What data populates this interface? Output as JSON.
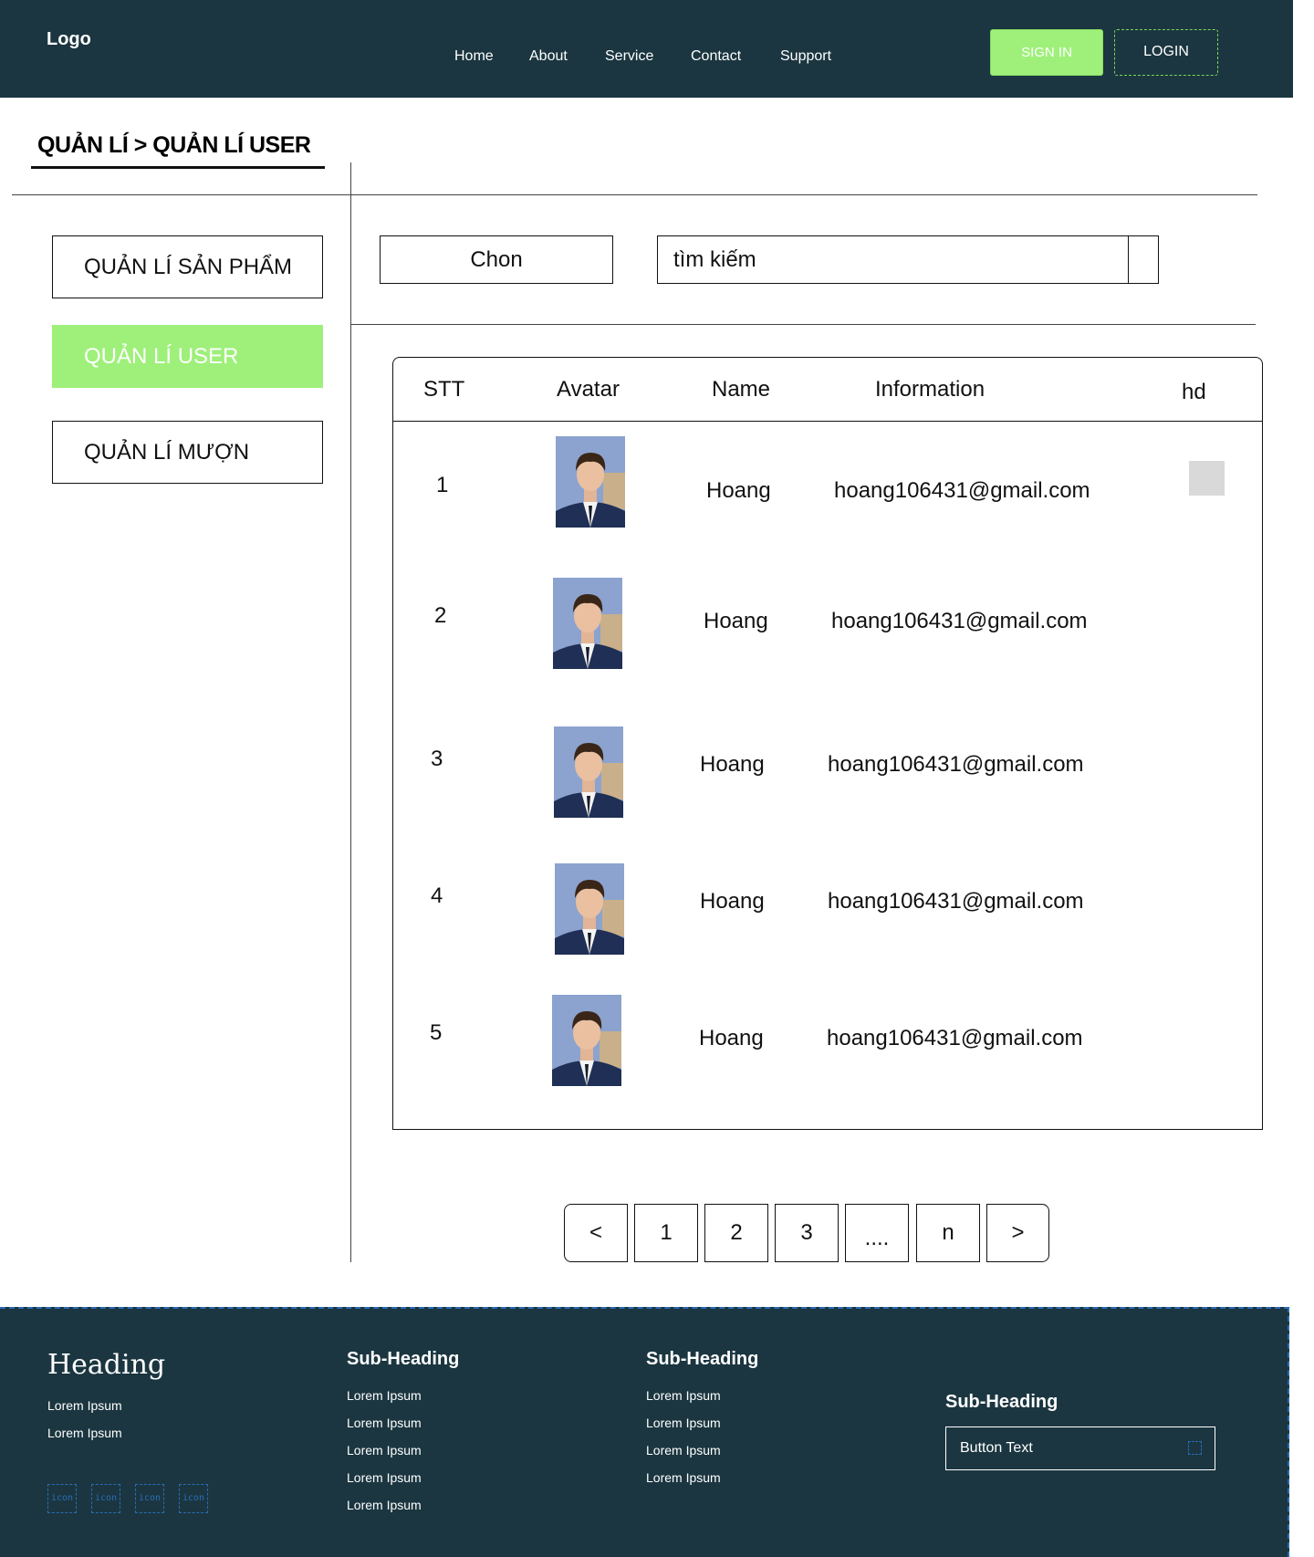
{
  "header": {
    "logo": "Logo",
    "nav": [
      "Home",
      "About",
      "Service",
      "Contact",
      "Support"
    ],
    "signin_label": "SIGN IN",
    "login_label": "LOGIN"
  },
  "breadcrumb": "QUẢN LÍ > QUẢN LÍ USER",
  "sidebar": {
    "items": [
      {
        "label": "QUẢN LÍ SẢN PHẨM",
        "active": false
      },
      {
        "label": "QUẢN LÍ USER",
        "active": true
      },
      {
        "label": "QUẢN LÍ MƯỢN",
        "active": false
      }
    ]
  },
  "filter": {
    "select_label": "Chon",
    "search_placeholder": "tìm kiếm"
  },
  "table": {
    "headers": [
      "STT",
      "Avatar",
      "Name",
      "Information",
      "hd"
    ],
    "rows": [
      {
        "stt": "1",
        "name": "Hoang",
        "info": "hoang106431@gmail.com"
      },
      {
        "stt": "2",
        "name": "Hoang",
        "info": "hoang106431@gmail.com"
      },
      {
        "stt": "3",
        "name": "Hoang",
        "info": "hoang106431@gmail.com"
      },
      {
        "stt": "4",
        "name": "Hoang",
        "info": "hoang106431@gmail.com"
      },
      {
        "stt": "5",
        "name": "Hoang",
        "info": "hoang106431@gmail.com"
      }
    ]
  },
  "pagination": [
    "<",
    "1",
    "2",
    "3",
    "....",
    "n",
    ">"
  ],
  "footer": {
    "heading": "Heading",
    "heading_links": [
      "Lorem Ipsum",
      "Lorem Ipsum"
    ],
    "icons": [
      "icon",
      "icon",
      "icon",
      "icon"
    ],
    "col1": {
      "title": "Sub-Heading",
      "links": [
        "Lorem Ipsum",
        "Lorem Ipsum",
        "Lorem Ipsum",
        "Lorem Ipsum",
        "Lorem Ipsum"
      ]
    },
    "col2": {
      "title": "Sub-Heading",
      "links": [
        "Lorem Ipsum",
        "Lorem Ipsum",
        "Lorem Ipsum",
        "Lorem Ipsum"
      ]
    },
    "col3": {
      "title": "Sub-Heading",
      "button_label": "Button Text"
    }
  },
  "colors": {
    "dark": "#1b3640",
    "accent": "#9ef07a"
  }
}
